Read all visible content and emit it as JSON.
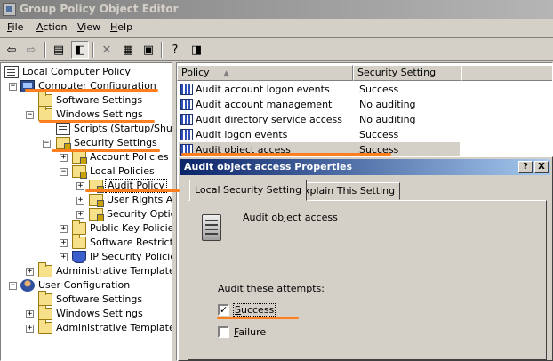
{
  "window": {
    "title": "Group Policy Object Editor"
  },
  "menu": {
    "items": [
      "File",
      "Action",
      "View",
      "Help"
    ]
  },
  "toolbar": {
    "buttons": [
      "back-icon",
      "forward-icon",
      "up-folder-icon",
      "show-hide-tree-icon",
      "delete-icon",
      "properties-icon",
      "export-icon",
      "help-icon",
      "console-icon"
    ]
  },
  "tree": {
    "items": [
      {
        "label": "Local Computer Policy",
        "icon": "policy-icon"
      },
      {
        "label": "Computer Configuration",
        "icon": "computer-icon"
      },
      {
        "label": "Software Settings",
        "icon": "folder-icon"
      },
      {
        "label": "Windows Settings",
        "icon": "folder-icon"
      },
      {
        "label": "Scripts (Startup/Shutdo",
        "icon": "script-icon"
      },
      {
        "label": "Security Settings",
        "icon": "security-icon"
      },
      {
        "label": "Account Policies",
        "icon": "folder-icon"
      },
      {
        "label": "Local Policies",
        "icon": "folder-icon"
      },
      {
        "label": "Audit Policy",
        "icon": "folder-icon"
      },
      {
        "label": "User Rights As",
        "icon": "folder-icon"
      },
      {
        "label": "Security Option",
        "icon": "folder-icon"
      },
      {
        "label": "Public Key Policies",
        "icon": "folder-icon"
      },
      {
        "label": "Software Restrictic",
        "icon": "folder-icon"
      },
      {
        "label": "IP Security Policies",
        "icon": "shield-icon"
      },
      {
        "label": "Administrative Templates",
        "icon": "folder-icon"
      },
      {
        "label": "User Configuration",
        "icon": "user-icon"
      },
      {
        "label": "Software Settings",
        "icon": "folder-icon"
      },
      {
        "label": "Windows Settings",
        "icon": "folder-icon"
      },
      {
        "label": "Administrative Templates",
        "icon": "folder-icon"
      }
    ]
  },
  "list": {
    "columns": [
      "Policy",
      "Security Setting"
    ],
    "sort_indicator": "▲",
    "rows": [
      {
        "policy": "Audit account logon events",
        "setting": "Success"
      },
      {
        "policy": "Audit account management",
        "setting": "No auditing"
      },
      {
        "policy": "Audit directory service access",
        "setting": "No auditing"
      },
      {
        "policy": "Audit logon events",
        "setting": "Success"
      },
      {
        "policy": "Audit object access",
        "setting": "Success"
      }
    ]
  },
  "dialog": {
    "title": "Audit object access Properties",
    "help_button": "?",
    "close_button": "X",
    "tabs": [
      "Local Security Setting",
      "Explain This Setting"
    ],
    "policy_name": "Audit object access",
    "group_label": "Audit these attempts:",
    "success_label": "Success",
    "success_checked": true,
    "failure_label": "Failure",
    "failure_checked": false,
    "check_glyph": "✓"
  },
  "colors": {
    "annotation": "#ff7f1f",
    "dialog_title": "#0a246a"
  }
}
